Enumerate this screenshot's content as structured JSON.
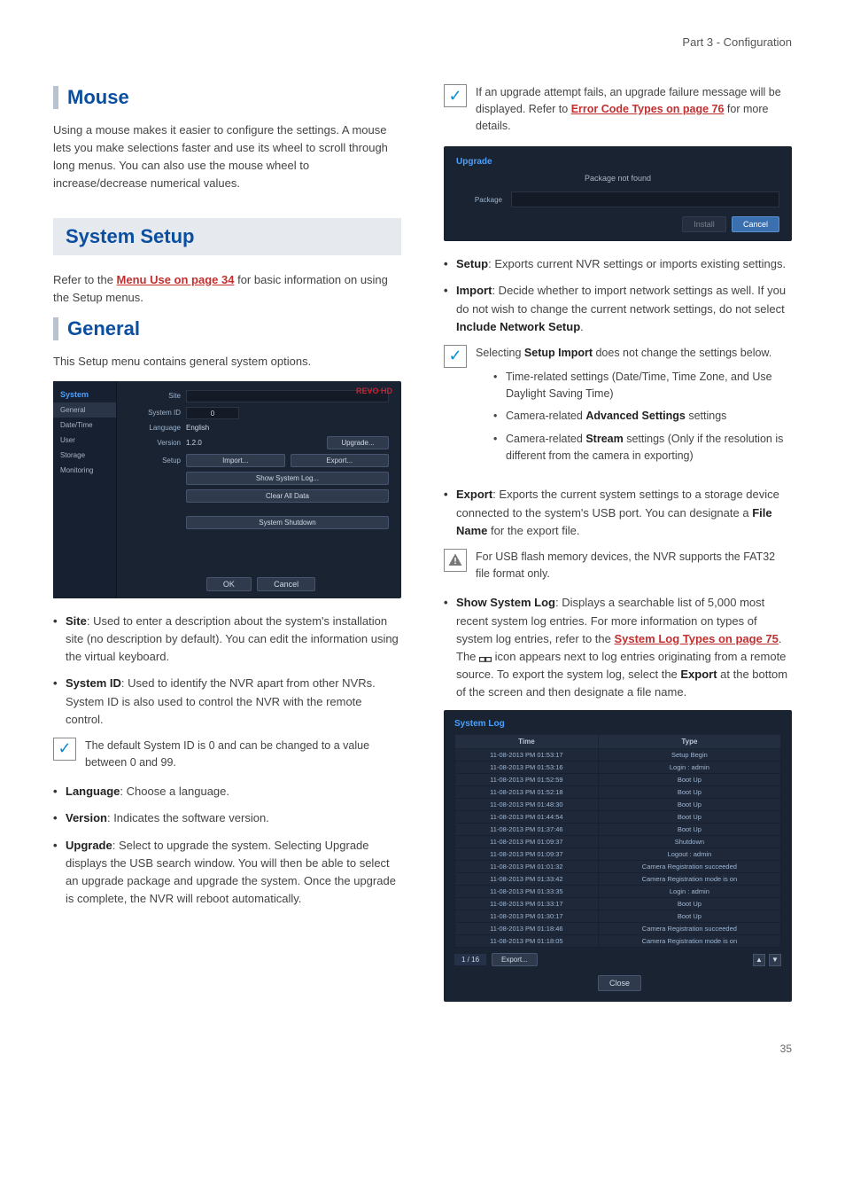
{
  "header": {
    "part": "Part 3 - Configuration"
  },
  "page_number": "35",
  "left": {
    "mouse": {
      "title": "Mouse",
      "body": "Using a mouse makes it easier to configure the settings. A mouse lets you make selections faster and use its wheel to scroll through long menus. You can also use the mouse wheel to increase/decrease numerical values."
    },
    "system_setup": {
      "title": "System Setup",
      "lead_pre": "Refer to the ",
      "lead_link": "Menu Use on page 34",
      "lead_post": " for basic information on using the Setup menus."
    },
    "general": {
      "title": "General",
      "intro": "This Setup menu contains general system options.",
      "sidebar_title": "System",
      "sidebar_items": [
        "General",
        "Date/Time",
        "User",
        "Storage",
        "Monitoring"
      ],
      "logo": "REVO HD",
      "labels": {
        "site": "Site",
        "system_id": "System ID",
        "language": "Language",
        "version": "Version",
        "setup": "Setup"
      },
      "values": {
        "system_id": "0",
        "language": "English",
        "version": "1.2.0"
      },
      "buttons": {
        "upgrade": "Upgrade...",
        "import": "Import...",
        "export": "Export...",
        "show_log": "Show System Log...",
        "clear": "Clear All Data",
        "shutdown": "System Shutdown",
        "ok": "OK",
        "cancel": "Cancel"
      },
      "bullets": {
        "site": {
          "term": "Site",
          "text": ": Used to enter a description about the system's installation site (no description by default). You can edit the information using the virtual keyboard."
        },
        "system_id": {
          "term": "System ID",
          "text": ": Used to identify the NVR apart from other NVRs. System ID is also used to control the NVR with the remote control."
        },
        "note": "The default System ID is 0 and can be changed to a value between 0 and 99.",
        "language": {
          "term": "Language",
          "text": ": Choose a language."
        },
        "version": {
          "term": "Version",
          "text": ": Indicates the software version."
        },
        "upgrade": {
          "term": "Upgrade",
          "text": ": Select to upgrade the system. Selecting Upgrade displays the USB search window. You will then be able to select an upgrade package and upgrade the system. Once the upgrade is complete, the NVR will reboot automatically."
        }
      }
    }
  },
  "right": {
    "upgrade_note": {
      "pre": "If an upgrade attempt fails, an upgrade failure message will be displayed. Refer to ",
      "link": "Error Code Types on page 76",
      "post": " for more details."
    },
    "upgrade_panel": {
      "title": "Upgrade",
      "message": "Package not found",
      "package_label": "Package",
      "install": "Install",
      "cancel": "Cancel"
    },
    "setup_bullet": {
      "term": "Setup",
      "text": ": Exports current NVR settings or imports existing settings."
    },
    "import_bullet": {
      "term": "Import",
      "text": ": Decide whether to import network settings as well. If you do not wish to change the current network settings, do not select ",
      "bold": "Include Network Setup",
      "post": "."
    },
    "import_note": {
      "lead_pre": "Selecting ",
      "lead_bold": "Setup Import",
      "lead_post": " does not change the settings below.",
      "subs": [
        {
          "text": "Time-related settings (Date/Time, Time Zone, and Use Daylight Saving Time)"
        },
        {
          "pre": "Camera-related ",
          "bold": "Advanced Settings",
          "post": " settings"
        },
        {
          "pre": "Camera-related ",
          "bold": "Stream",
          "post": " settings (Only if the resolution is different from the camera in exporting)"
        }
      ]
    },
    "export_bullet": {
      "term": "Export",
      "pre": ": Exports the current system settings to a storage device connected to the system's USB port. You can designate a ",
      "bold": "File Name",
      "post": " for the export file."
    },
    "export_warn": "For USB flash memory devices, the NVR supports the FAT32 file format only.",
    "showlog_bullet": {
      "term": "Show System Log",
      "pre": ": Displays a searchable list of 5,000 most recent system log entries. For more information on types of system log entries, refer to the ",
      "link": "System Log Types on page 75",
      "mid": ". The ",
      "post": " icon appears next to log entries originating from a remote source. To export the system log, select the ",
      "bold2": "Export",
      "post2": " at the bottom of the screen and then designate a file name."
    },
    "log_panel": {
      "title": "System Log",
      "headers": [
        "Time",
        "Type"
      ],
      "rows": [
        [
          "11-08-2013  PM 01:53:17",
          "Setup Begin"
        ],
        [
          "11-08-2013  PM 01:53:16",
          "Login : admin"
        ],
        [
          "11-08-2013  PM 01:52:59",
          "Boot Up"
        ],
        [
          "11-08-2013  PM 01:52:18",
          "Boot Up"
        ],
        [
          "11-08-2013  PM 01:48:30",
          "Boot Up"
        ],
        [
          "11-08-2013  PM 01:44:54",
          "Boot Up"
        ],
        [
          "11-08-2013  PM 01:37:46",
          "Boot Up"
        ],
        [
          "11-08-2013  PM 01:09:37",
          "Shutdown"
        ],
        [
          "11-08-2013  PM 01:09:37",
          "Logout : admin"
        ],
        [
          "11-08-2013  PM 01:01:32",
          "Camera Registration succeeded"
        ],
        [
          "11-08-2013  PM 01:33:42",
          "Camera Registration mode is on"
        ],
        [
          "11-08-2013  PM 01:33:35",
          "Login : admin"
        ],
        [
          "11-08-2013  PM 01:33:17",
          "Boot Up"
        ],
        [
          "11-08-2013  PM 01:30:17",
          "Boot Up"
        ],
        [
          "11-08-2013  PM 01:18:46",
          "Camera Registration succeeded"
        ],
        [
          "11-08-2013  PM 01:18:05",
          "Camera Registration mode is on"
        ]
      ],
      "pager": "1 / 16",
      "export": "Export...",
      "close": "Close"
    }
  }
}
